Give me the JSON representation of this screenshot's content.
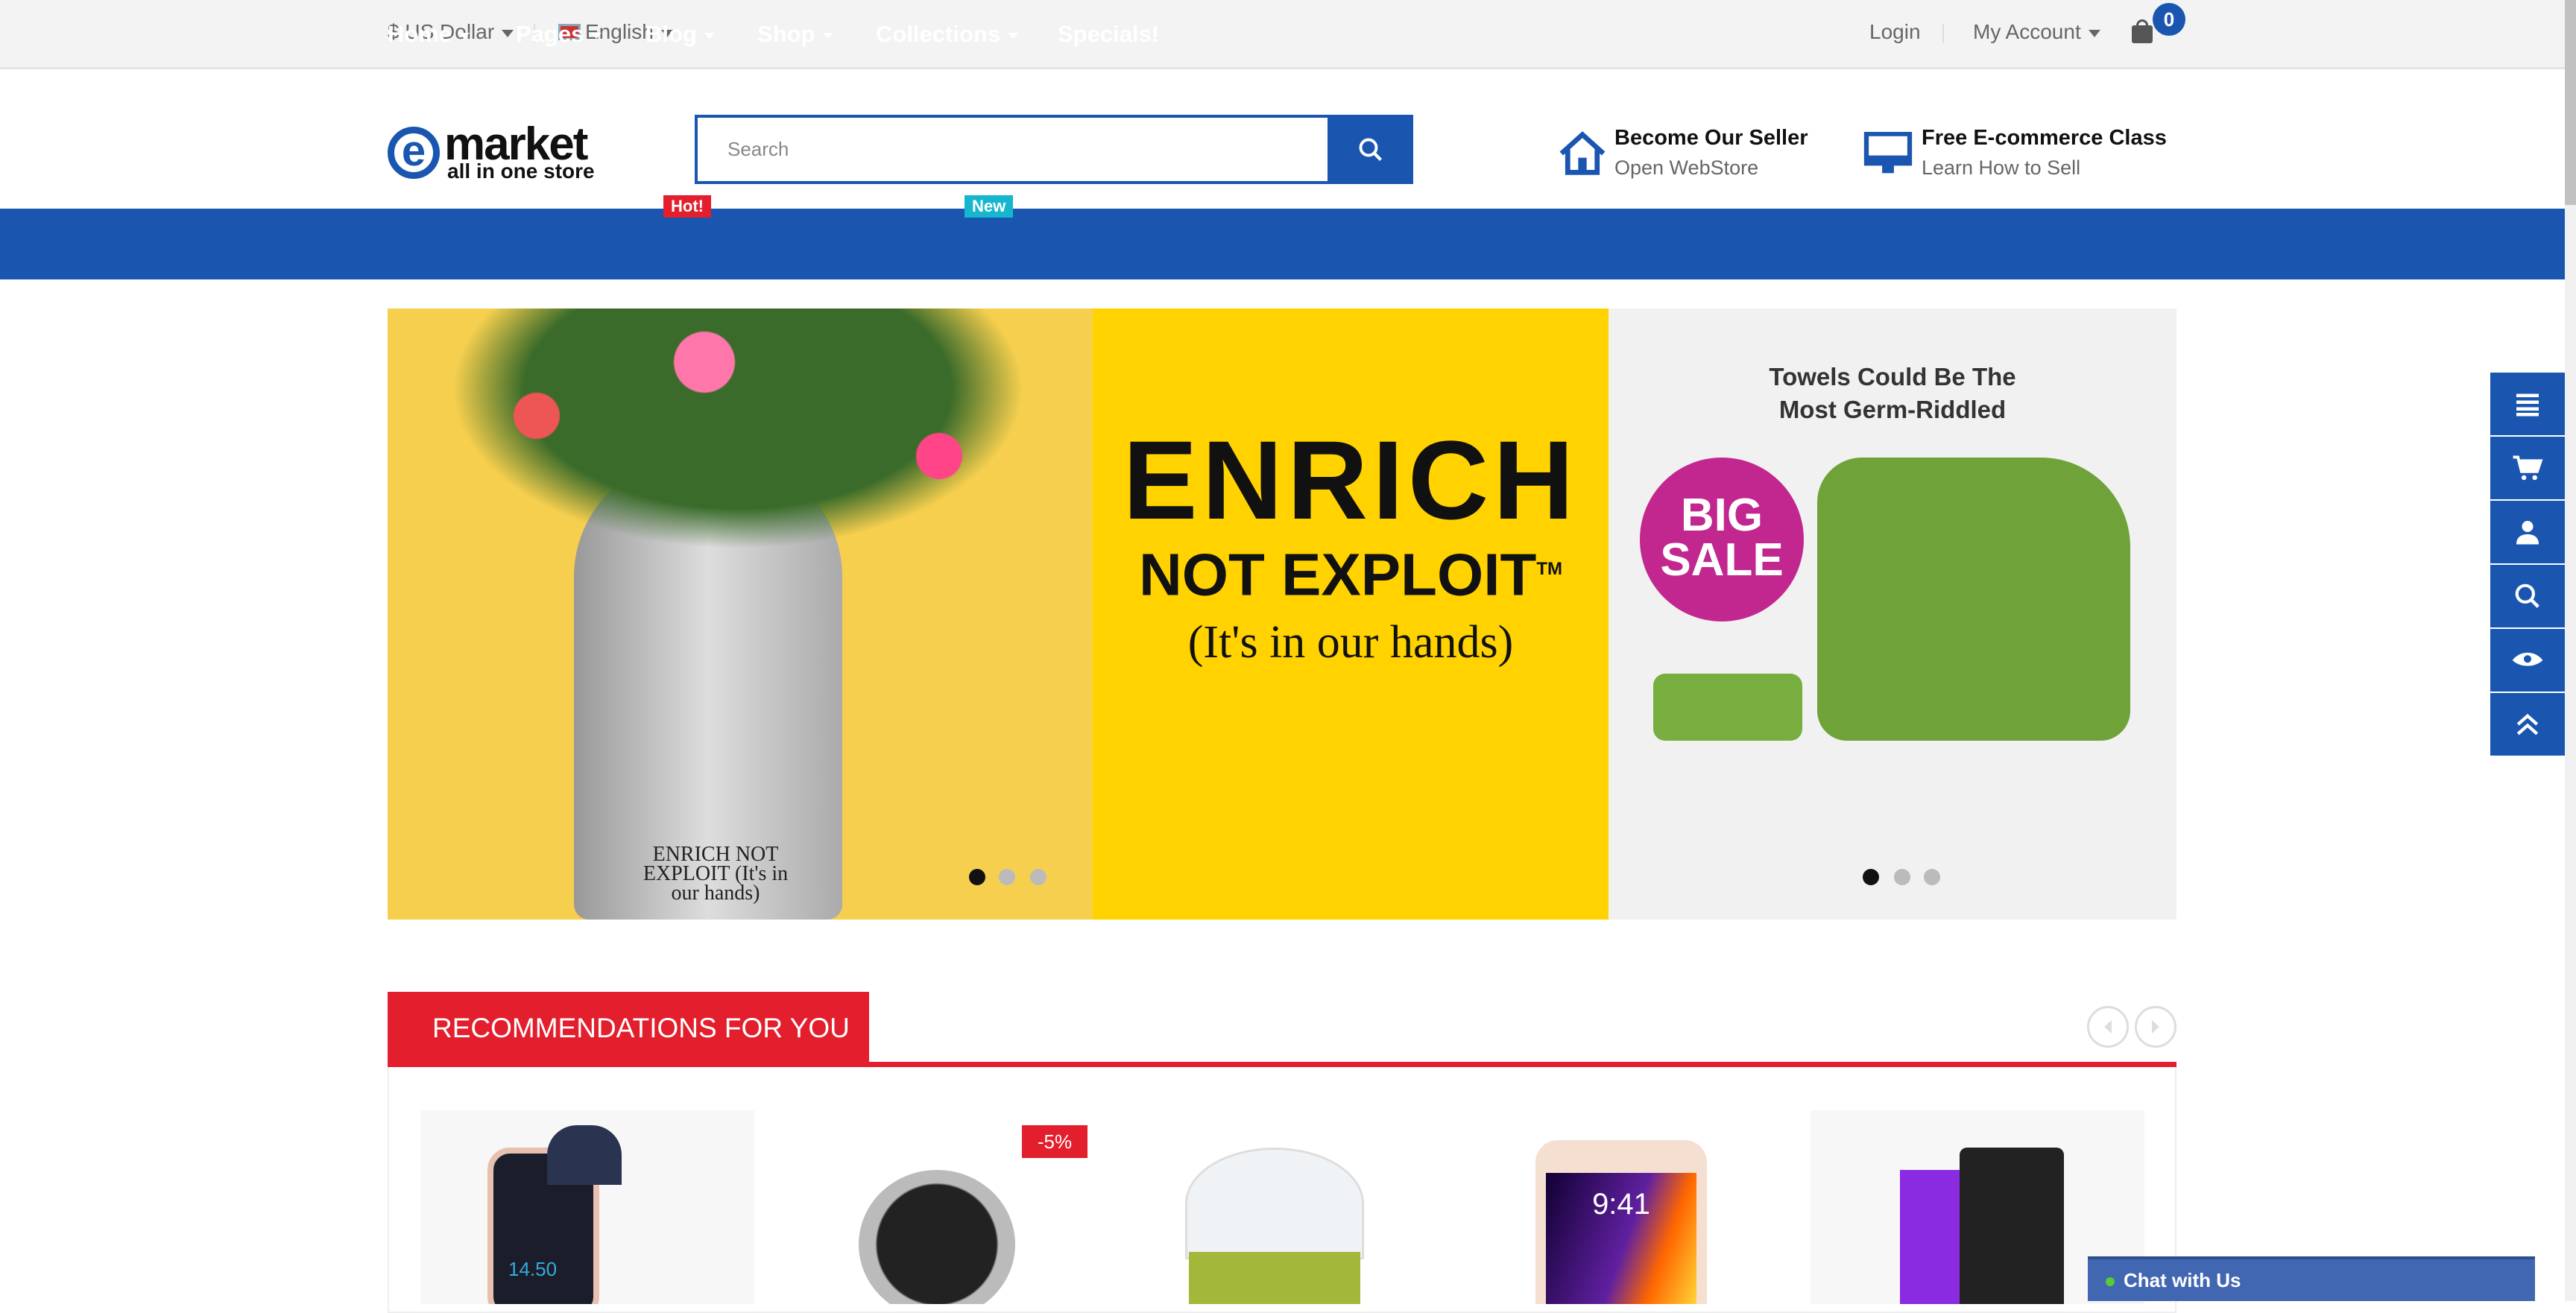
{
  "topbar": {
    "currency": "$ US Dollar",
    "language": "English",
    "login": "Login",
    "account": "My Account",
    "cart_count": "0"
  },
  "logo": {
    "name": "market",
    "tagline": "all in one store",
    "letter": "e"
  },
  "search": {
    "placeholder": "Search"
  },
  "promos": [
    {
      "title": "Become Our Seller",
      "subtitle": "Open WebStore",
      "icon": "house-icon"
    },
    {
      "title": "Free E-commerce Class",
      "subtitle": "Learn How to Sell",
      "icon": "monitor-icon"
    }
  ],
  "nav": {
    "items": [
      {
        "label": "Home"
      },
      {
        "label": "Pages"
      },
      {
        "label": "Blog",
        "tag": "Hot!"
      },
      {
        "label": "Shop"
      },
      {
        "label": "Collections",
        "tag": "New"
      },
      {
        "label": "Specials!"
      }
    ]
  },
  "banner": {
    "main_line1": "ENRICH",
    "main_line2": "NOT EXPLOIT",
    "tm": "TM",
    "main_line3": "(It's in our hands)",
    "wrist_text": "ENRICH NOT EXPLOIT (It's in our hands)",
    "right_line1": "Towels Could Be The",
    "right_line2": "Most Germ-Riddled",
    "sale_line1": "BIG",
    "sale_line2": "SALE"
  },
  "recommendations": {
    "title": "RECOMMENDATIONS FOR YOU",
    "badge": "-5%",
    "watch_time": "14.50",
    "phone_time": "9:41"
  },
  "chat": {
    "label": "Chat with Us"
  },
  "colors": {
    "brand": "#1a56b0",
    "accent": "#e31e2d",
    "banner_yellow": "#ffd200"
  }
}
